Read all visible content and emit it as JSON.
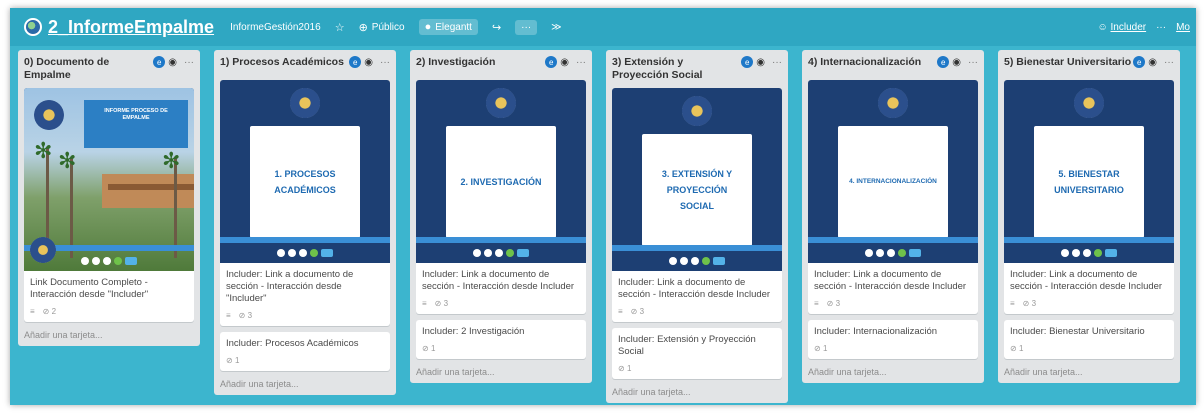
{
  "board": {
    "title": "2_InformeEmpalme",
    "organization": "InformeGestión2016",
    "star_icon": "star-icon",
    "visibility": "Público",
    "powerup": "Elegantt",
    "more": "···",
    "expand": "≫",
    "member": "Includer",
    "menu_more": "···",
    "menu_label": "Mo"
  },
  "add_card_label": "Añadir una tarjeta...",
  "lists": [
    {
      "title": "0) Documento de Empalme",
      "cover": {
        "style": "photo",
        "lines": [
          "INFORME PROCESO DE",
          "EMPALME"
        ]
      },
      "cards": [
        {
          "text": "Link Documento Completo - Interacción desde \"Includer\"",
          "comments_icon": "description-icon",
          "attachments": "2"
        }
      ]
    },
    {
      "title": "1) Procesos Académicos",
      "cover": {
        "style": "panel",
        "lines": [
          "1. PROCESOS",
          "ACADÉMICOS"
        ]
      },
      "cards": [
        {
          "text": "Includer: Link a documento de sección - Interacción desde \"Includer\"",
          "attachments": "3"
        },
        {
          "text": "Includer: Procesos Académicos",
          "attachments": "1"
        }
      ]
    },
    {
      "title": "2) Investigación",
      "cover": {
        "style": "panel",
        "lines": [
          "2. INVESTIGACIÓN"
        ]
      },
      "cards": [
        {
          "text": "Includer: Link a documento de sección - Interacción desde Includer",
          "attachments": "3"
        },
        {
          "text": "Includer: 2 Investigación",
          "attachments": "1"
        }
      ]
    },
    {
      "title": "3) Extensión y Proyección Social",
      "cover": {
        "style": "panel",
        "lines": [
          "3. EXTENSIÓN Y",
          "PROYECCIÓN",
          "SOCIAL"
        ]
      },
      "cards": [
        {
          "text": "Includer: Link a documento de sección - Interacción desde Includer",
          "attachments": "3"
        },
        {
          "text": "Includer: Extensión y Proyección Social",
          "attachments": "1"
        }
      ]
    },
    {
      "title": "4) Internacionalización",
      "cover": {
        "style": "panel",
        "lines": [
          "4. INTERNACIONALIZACIÓN"
        ]
      },
      "cards": [
        {
          "text": "Includer: Link a documento de sección - Interacción desde Includer",
          "attachments": "3"
        },
        {
          "text": "Includer: Internacionalización",
          "attachments": "1"
        }
      ]
    },
    {
      "title": "5) Bienestar Universitario",
      "cover": {
        "style": "panel",
        "lines": [
          "5. BIENESTAR",
          "UNIVERSITARIO"
        ]
      },
      "cards": [
        {
          "text": "Includer: Link a documento de sección - Interacción desde Includer",
          "attachments": "3"
        },
        {
          "text": "Includer: Bienestar Universitario",
          "attachments": "1"
        }
      ]
    }
  ],
  "colors": {
    "board_bg": "#3cb5ce",
    "list_bg": "#e2e4e6",
    "cover_navy": "#1d3f73",
    "panel_text": "#1e6ab1"
  }
}
